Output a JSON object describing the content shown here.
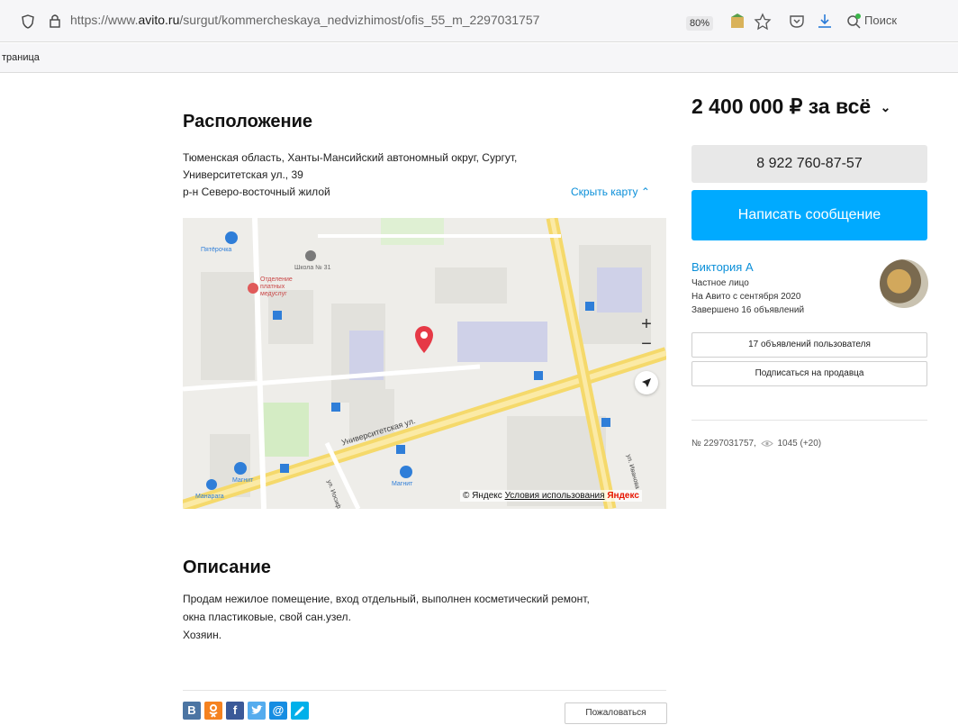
{
  "browser": {
    "url_prefix": "https://www.",
    "url_domain": "avito.ru",
    "url_path": "/surgut/kommercheskaya_nedvizhimost/ofis_55_m_2297031757",
    "zoom": "80%",
    "search_label": "Поиск",
    "bookmark_label": "траница"
  },
  "location": {
    "title": "Расположение",
    "address_line1": "Тюменская область, Ханты-Мансийский автономный округ, Сургут,",
    "address_line2": "Университетская ул., 39",
    "district": "р-н Северо-восточный жилой",
    "hide_map": "Скрыть карту ⌃"
  },
  "map": {
    "labels": [
      "Пятёрочка",
      "Школа № 31",
      "Отделение платных медуслуг",
      "Университетская ул.",
      "Магнит",
      "Магнит",
      "Манарага",
      "ул. Иосиф",
      "ул. Иванова"
    ],
    "zoom_in": "+",
    "zoom_out": "−",
    "credit_prefix": "© Яндекс",
    "credit_terms": "Условия использования",
    "credit_logo": "Яндекс"
  },
  "description": {
    "title": "Описание",
    "line1": "Продам нежилое помещение, вход отдельный, выполнен косметический ремонт,",
    "line2": "окна пластиковые, свой сан.узел.",
    "line3": "Хозяин."
  },
  "share": {
    "report": "Пожаловаться",
    "networks": [
      "vk-icon",
      "ok-icon",
      "facebook-icon",
      "twitter-icon",
      "mail-icon",
      "livejournal-icon"
    ]
  },
  "sidebar": {
    "price": "2 400 000 ₽ за всё",
    "phone": "8 922 760-87-57",
    "write": "Написать сообщение",
    "seller_name": "Виктория А",
    "seller_type": "Частное лицо",
    "seller_since": "На Авито с сентября 2020",
    "seller_completed": "Завершено 16 объявлений",
    "user_ads": "17 объявлений пользователя",
    "subscribe": "Подписаться на продавца",
    "ad_number": "№ 2297031757,",
    "views": "1045 (+20)"
  },
  "colors": {
    "accent_blue": "#00aaff",
    "link_blue": "#0a8fd9",
    "map_road": "#f5d96b",
    "map_pin": "#e63946"
  }
}
